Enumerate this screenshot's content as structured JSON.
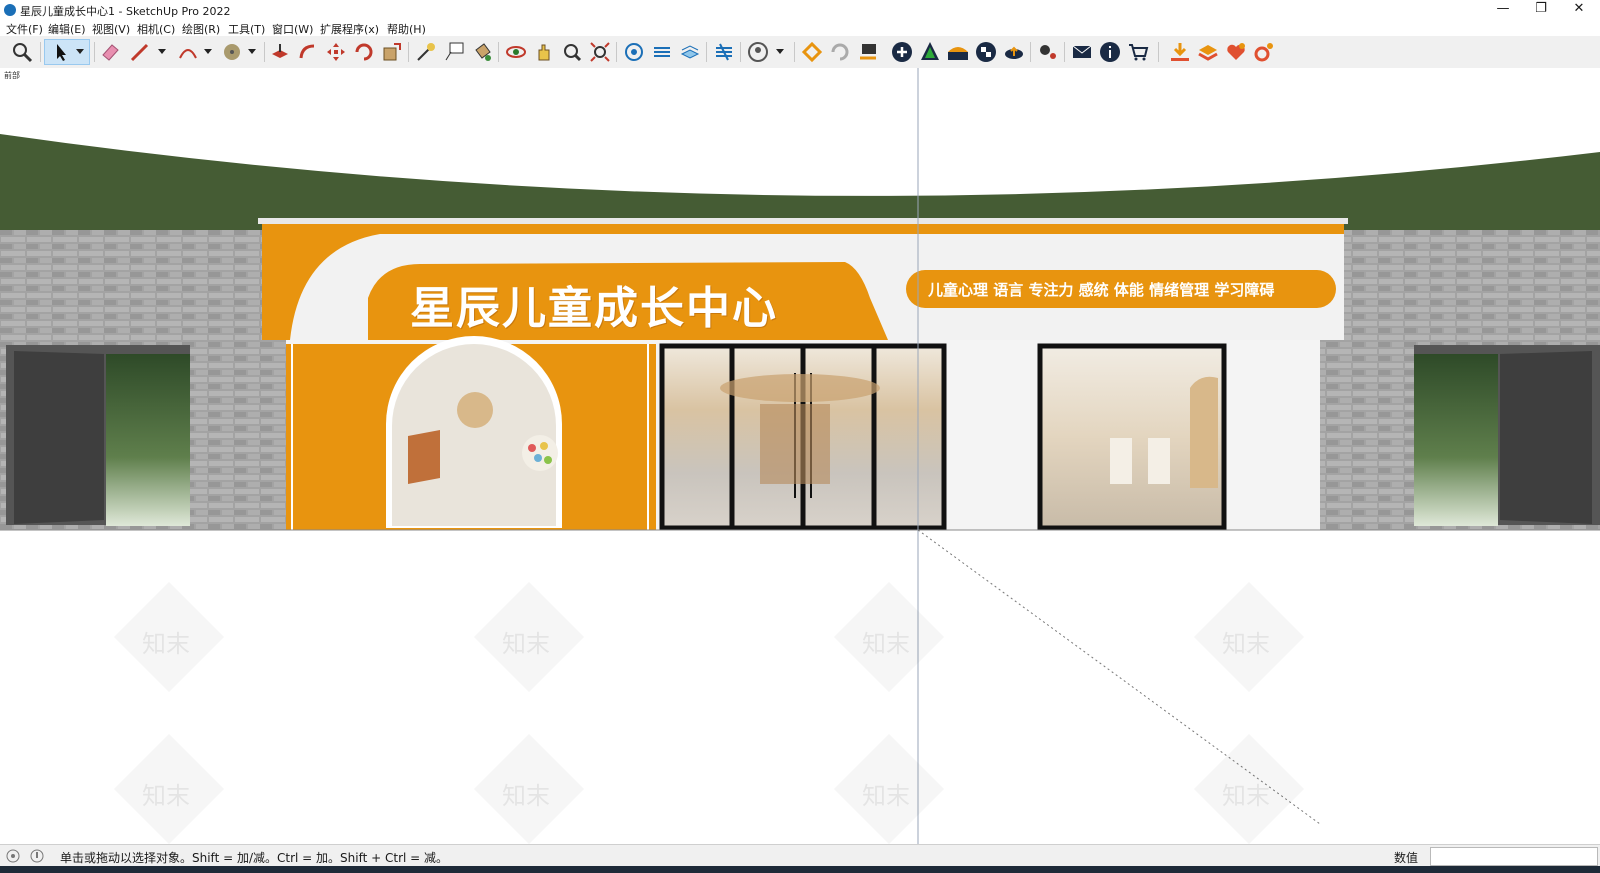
{
  "window": {
    "title": "星辰儿童成长中心1 - SketchUp Pro 2022",
    "minimize": "—",
    "restore": "❐",
    "close": "✕"
  },
  "menu": [
    "文件(F)",
    "编辑(E)",
    "视图(V)",
    "相机(C)",
    "绘图(R)",
    "工具(T)",
    "窗口(W)",
    "扩展程序(x)",
    "帮助(H)"
  ],
  "toolbar_icons": [
    "zoom-icon",
    "select-icon",
    "eraser-icon",
    "pencil-icon",
    "arc-icon",
    "tape-icon",
    "push-pull-icon",
    "follow-me-icon",
    "move-icon",
    "rotate-icon",
    "scale-icon",
    "tape-measure-icon",
    "text-icon",
    "paint-bucket-icon",
    "orbit-icon",
    "pan-icon",
    "zoom-window-icon",
    "zoom-extents-icon",
    "component-icon",
    "layer-icon",
    "style-icon",
    "section-icon",
    "account-icon",
    "extension-warehouse-icon",
    "refresh-icon",
    "export-icon",
    "add-icon",
    "tree-icon",
    "terrain-icon",
    "checker-icon",
    "cloud-icon",
    "settings-icon",
    "mail-icon",
    "info-icon",
    "cart-icon",
    "download-icon",
    "layers-icon",
    "heart-icon",
    "gear-icon"
  ],
  "scene": {
    "label": "前部",
    "sign_title": "星辰儿童成长中心",
    "sign_services": "儿童心理 语言 专注力 感统 体能 情绪管理 学习障碍",
    "watermark": "知末"
  },
  "colors": {
    "orange": "#e8940f",
    "green": "#455c34",
    "brick": "#9a9a9a",
    "signWhite": "#f2f2f2"
  },
  "status": {
    "hint": "单击或拖动以选择对象。Shift = 加/减。Ctrl = 加。Shift + Ctrl = 减。",
    "measure_label": "数值",
    "measure_value": ""
  }
}
